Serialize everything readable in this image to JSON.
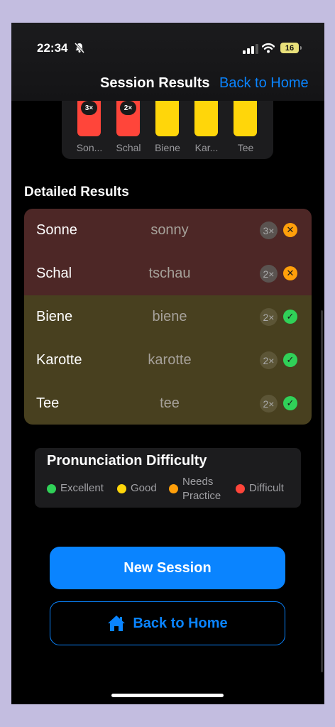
{
  "status_bar": {
    "time": "22:34",
    "battery": "16"
  },
  "nav": {
    "title": "Session Results",
    "back_label": "Back to Home"
  },
  "mini_chart": {
    "items": [
      {
        "label": "Son...",
        "badge": "3×",
        "color": "#ff453a"
      },
      {
        "label": "Schal",
        "badge": "2×",
        "color": "#ff453a"
      },
      {
        "label": "Biene",
        "badge": "",
        "color": "#ffd60a"
      },
      {
        "label": "Kar...",
        "badge": "",
        "color": "#ffd60a"
      },
      {
        "label": "Tee",
        "badge": "",
        "color": "#ffd60a"
      }
    ]
  },
  "detailed": {
    "title": "Detailed Results",
    "rows": [
      {
        "word": "Sonne",
        "heard": "sonny",
        "count": "3×",
        "result": "wrong"
      },
      {
        "word": "Schal",
        "heard": "tschau",
        "count": "2×",
        "result": "wrong"
      },
      {
        "word": "Biene",
        "heard": "biene",
        "count": "2×",
        "result": "correct"
      },
      {
        "word": "Karotte",
        "heard": "karotte",
        "count": "2×",
        "result": "correct"
      },
      {
        "word": "Tee",
        "heard": "tee",
        "count": "2×",
        "result": "correct"
      }
    ]
  },
  "legend": {
    "title": "Pronunciation Difficulty",
    "items": [
      {
        "label": "Excellent",
        "color": "#30d158"
      },
      {
        "label": "Good",
        "color": "#ffd60a"
      },
      {
        "label": "Needs Practice",
        "label_line1": "Needs",
        "label_line2": "Practice",
        "color": "#ff9f0a"
      },
      {
        "label": "Difficult",
        "color": "#ff453a"
      }
    ]
  },
  "actions": {
    "new_session": "New Session",
    "back_home": "Back to Home"
  },
  "colors": {
    "accent": "#0a84ff",
    "wrong": "#ff9f0a",
    "correct": "#30d158"
  }
}
